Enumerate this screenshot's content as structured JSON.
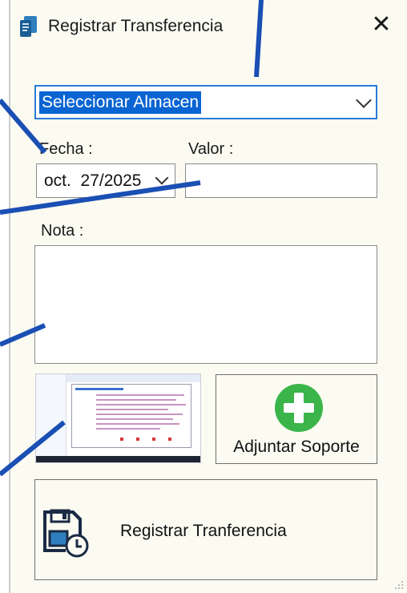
{
  "dialog": {
    "title": "Registrar Transferencia",
    "close_glyph": "✕"
  },
  "form": {
    "almacen": {
      "value": "Seleccionar Almacen",
      "icon": "chevron-down-icon"
    },
    "fecha": {
      "label": "Fecha :",
      "value": "oct.  27/2025",
      "icon": "chevron-down-icon"
    },
    "valor": {
      "label": "Valor :",
      "value": ""
    },
    "nota": {
      "label": "Nota :",
      "value": ""
    }
  },
  "buttons": {
    "attach_label": "Adjuntar Soporte",
    "register_label": "Registrar Tranferencia"
  },
  "icons": {
    "app": "app-icon",
    "close": "close-icon",
    "attach": "plus-circle-icon",
    "register": "save-clock-icon"
  },
  "colors": {
    "dialog_bg": "#fbfbf2",
    "selection": "#0a64d2",
    "focus_border": "#2a7ad6",
    "plus_green": "#3bb54a",
    "annotation_blue": "#1a4fb4"
  }
}
